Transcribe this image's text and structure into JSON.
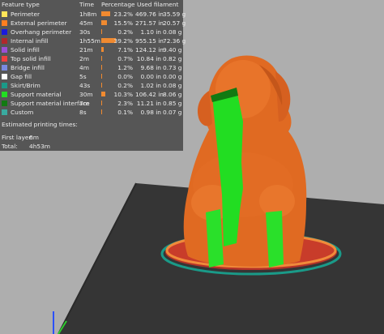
{
  "legend": {
    "headers": {
      "feature_type": "Feature type",
      "time": "Time",
      "percentage": "Percentage",
      "used_filament": "Used filament"
    },
    "rows": [
      {
        "name": "Perimeter",
        "time": "1h8m",
        "percent": "23.2%",
        "length": "469.76 in",
        "weight": "35.59 g",
        "color": "#ffe659",
        "bar_fraction": 0.232
      },
      {
        "name": "External perimeter",
        "time": "45m",
        "percent": "15.5%",
        "length": "271.57 in",
        "weight": "20.57 g",
        "color": "#ff7f20",
        "bar_fraction": 0.155
      },
      {
        "name": "Overhang perimeter",
        "time": "30s",
        "percent": "0.2%",
        "length": "1.10 in",
        "weight": "0.08 g",
        "color": "#1a1adc",
        "bar_fraction": 0.002
      },
      {
        "name": "Internal infill",
        "time": "1h55m",
        "percent": "39.2%",
        "length": "955.15 in",
        "weight": "72.36 g",
        "color": "#b0282c",
        "bar_fraction": 0.392
      },
      {
        "name": "Solid infill",
        "time": "21m",
        "percent": "7.1%",
        "length": "124.12 in",
        "weight": "9.40 g",
        "color": "#9a4fd6",
        "bar_fraction": 0.071
      },
      {
        "name": "Top solid infill",
        "time": "2m",
        "percent": "0.7%",
        "length": "10.84 in",
        "weight": "0.82 g",
        "color": "#f04040",
        "bar_fraction": 0.007
      },
      {
        "name": "Bridge infill",
        "time": "4m",
        "percent": "1.2%",
        "length": "9.68 in",
        "weight": "0.73 g",
        "color": "#7a8ae0",
        "bar_fraction": 0.012
      },
      {
        "name": "Gap fill",
        "time": "5s",
        "percent": "0.0%",
        "length": "0.00 in",
        "weight": "0.00 g",
        "color": "#ffffff",
        "bar_fraction": 0.0
      },
      {
        "name": "Skirt/Brim",
        "time": "43s",
        "percent": "0.2%",
        "length": "1.02 in",
        "weight": "0.08 g",
        "color": "#1a9a88",
        "bar_fraction": 0.002
      },
      {
        "name": "Support material",
        "time": "30m",
        "percent": "10.3%",
        "length": "106.42 in",
        "weight": "8.06 g",
        "color": "#22dd22",
        "bar_fraction": 0.103
      },
      {
        "name": "Support material interface",
        "time": "7m",
        "percent": "2.3%",
        "length": "11.21 in",
        "weight": "0.85 g",
        "color": "#127a12",
        "bar_fraction": 0.023
      },
      {
        "name": "Custom",
        "time": "8s",
        "percent": "0.1%",
        "length": "0.98 in",
        "weight": "0.07 g",
        "color": "#3aaaa0",
        "bar_fraction": 0.001
      }
    ],
    "estimated_title": "Estimated printing times:",
    "first_layer_label": "First layer:",
    "first_layer_value": "6m",
    "total_label": "Total:",
    "total_value": "4h53m"
  },
  "colors": {
    "background": "#aeaeae",
    "bed": "#3a3a3a",
    "model_orange": "#e06a22",
    "support_green": "#22dd22"
  }
}
